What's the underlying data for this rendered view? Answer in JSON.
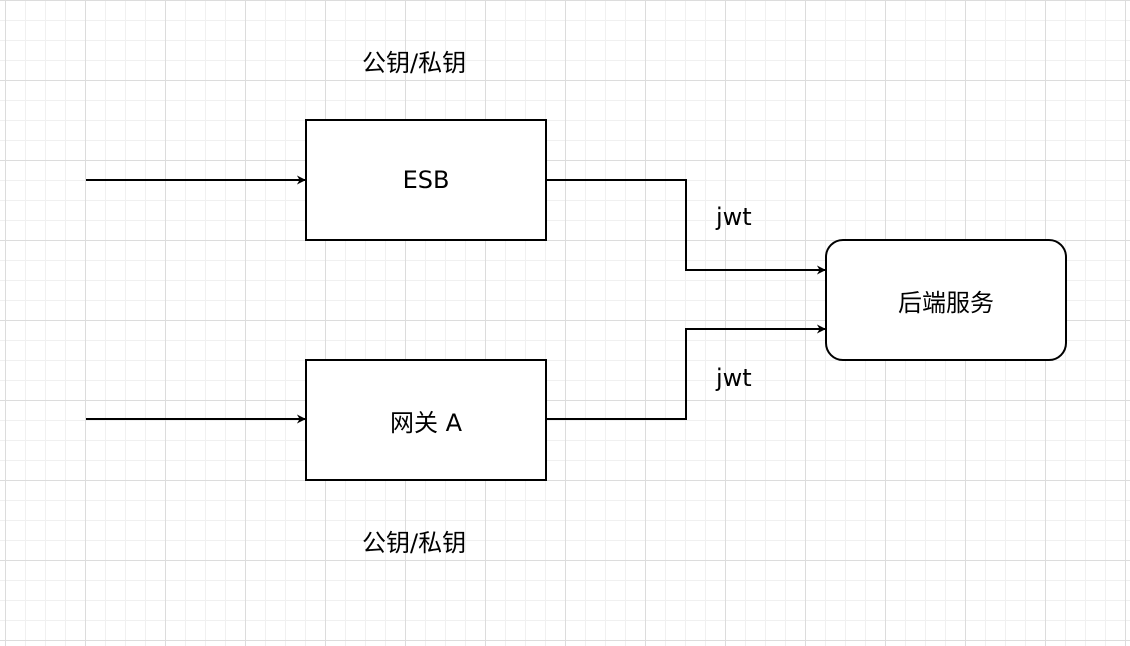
{
  "nodes": {
    "esb": {
      "label": "ESB"
    },
    "gateway": {
      "label": "网关 A"
    },
    "backend": {
      "label": "后端服务"
    }
  },
  "labels": {
    "esb_key": "公钥/私钥",
    "gateway_key": "公钥/私钥",
    "jwt_top": "jwt",
    "jwt_bottom": "jwt"
  },
  "colors": {
    "stroke": "#000000",
    "grid_major": "#dcdcdc",
    "grid_minor": "#f0f0f0",
    "background": "#ffffff"
  }
}
